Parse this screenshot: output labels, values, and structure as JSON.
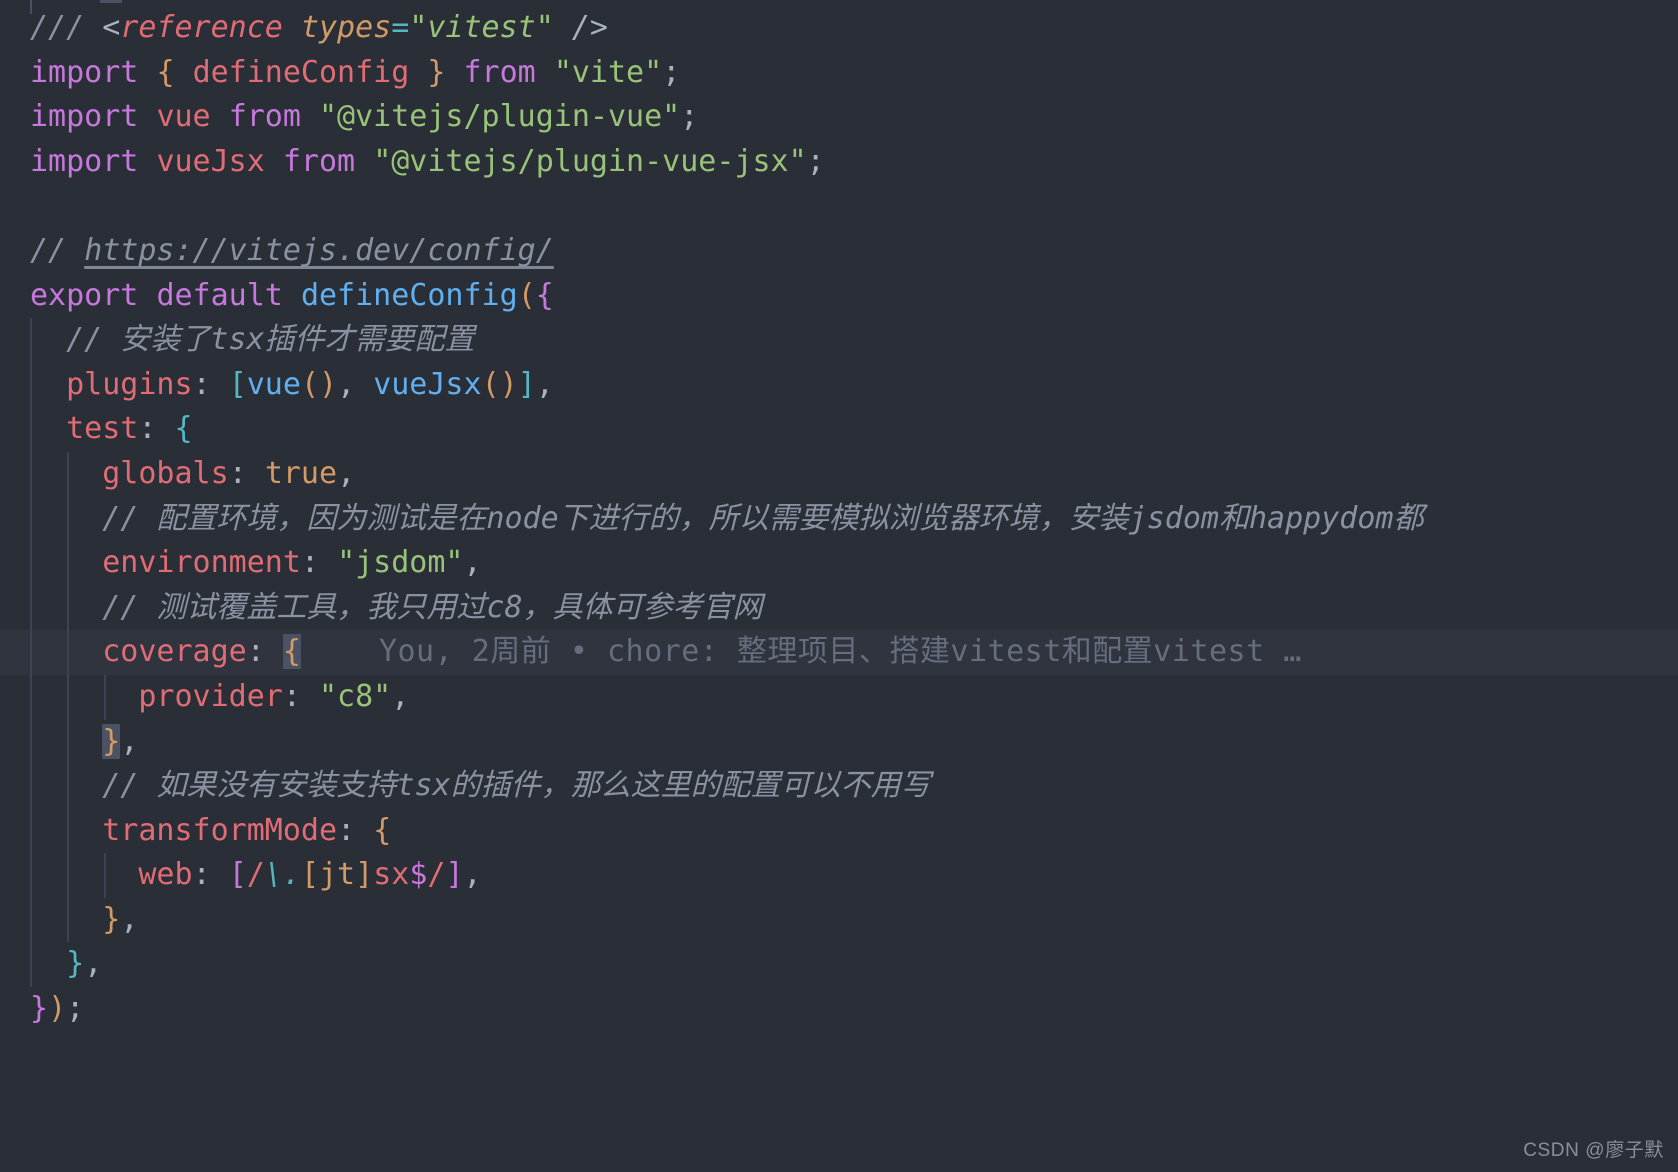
{
  "editor": {
    "file_kind": "vite-config",
    "theme": {
      "background": "#2a2e37",
      "highlight_line": "#2f343f",
      "default_text": "#abb2bf",
      "comment": "#8a91a0",
      "keyword": "#c678dd",
      "string": "#98c379",
      "property": "#e06c75",
      "function": "#61afef",
      "number": "#d19a66",
      "operator": "#56b6c2",
      "bracket_match": "#4b5263",
      "blame_text": "#676d7d"
    }
  },
  "code": {
    "line01": {
      "tripleslash": "///",
      "lt": "<",
      "tag": "reference",
      "attr": "types",
      "eq": "=",
      "value": "\"vitest\"",
      "close": "/>"
    },
    "line02": {
      "import": "import",
      "brace_open": "{",
      "name": "defineConfig",
      "brace_close": "}",
      "from": "from",
      "module": "\"vite\"",
      "semi": ";"
    },
    "line03": {
      "import": "import",
      "name": "vue",
      "from": "from",
      "module": "\"@vitejs/plugin-vue\"",
      "semi": ";"
    },
    "line04": {
      "import": "import",
      "name": "vueJsx",
      "from": "from",
      "module": "\"@vitejs/plugin-vue-jsx\"",
      "semi": ";"
    },
    "line05": {
      "blank": ""
    },
    "line06": {
      "slashes": "//",
      "url": "https://vitejs.dev/config/"
    },
    "line07": {
      "export": "export",
      "default": "default",
      "fn": "defineConfig",
      "paren": "(",
      "brace": "{"
    },
    "line08": {
      "comment": "// 安装了tsx插件才需要配置"
    },
    "line09": {
      "prop": "plugins",
      "colon": ":",
      "lbracket": "[",
      "fn1": "vue",
      "call1": "()",
      "comma1": ",",
      "fn2": "vueJsx",
      "call2": "()",
      "rbracket": "]",
      "comma2": ","
    },
    "line10": {
      "prop": "test",
      "colon": ":",
      "brace": "{"
    },
    "line11": {
      "prop": "globals",
      "colon": ":",
      "value": "true",
      "comma": ","
    },
    "line12": {
      "comment": "// 配置环境，因为测试是在node下进行的，所以需要模拟浏览器环境，安装jsdom和happydom都"
    },
    "line13": {
      "prop": "environment",
      "colon": ":",
      "value": "\"jsdom\"",
      "comma": ","
    },
    "line14": {
      "comment": "// 测试覆盖工具，我只用过c8，具体可参考官网"
    },
    "line15": {
      "prop": "coverage",
      "colon": ":",
      "brace": "{",
      "blame": "You, 2周前 • chore: 整理项目、搭建vitest和配置vitest …"
    },
    "line16": {
      "prop": "provider",
      "colon": ":",
      "value": "\"c8\"",
      "comma": ","
    },
    "line17": {
      "brace": "}",
      "comma": ","
    },
    "line18": {
      "comment": "// 如果没有安装支持tsx的插件，那么这里的配置可以不用写"
    },
    "line19": {
      "prop": "transformMode",
      "colon": ":",
      "brace": "{"
    },
    "line20": {
      "prop": "web",
      "colon": ":",
      "lbracket": "[",
      "slash1": "/",
      "escape": "\\.",
      "set": "[jt]",
      "lit": "sx",
      "anchor": "$",
      "slash2": "/",
      "rbracket": "]",
      "comma": ","
    },
    "line21": {
      "brace": "}",
      "comma": ","
    },
    "line22": {
      "brace": "}",
      "comma": ","
    },
    "line23": {
      "brace": "}",
      "paren": ")",
      "semi": ";"
    }
  },
  "watermark": {
    "text": "CSDN @廖子默"
  }
}
